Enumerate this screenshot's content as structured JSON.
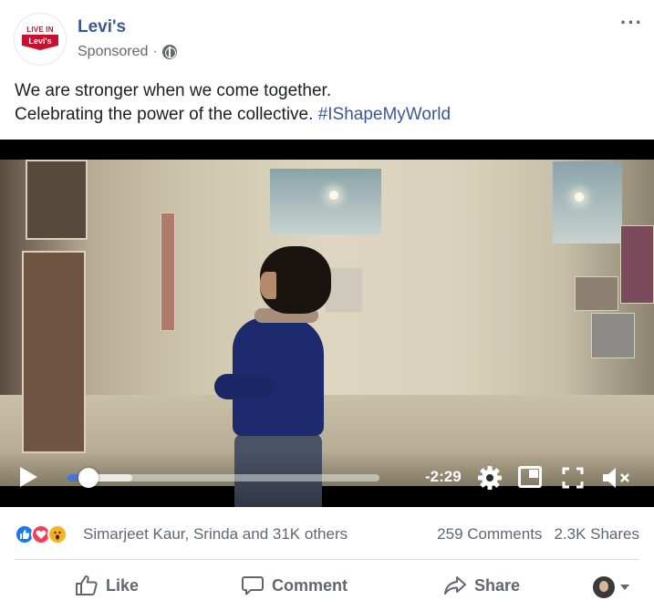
{
  "post": {
    "page_name": "Levi's",
    "sponsored_label": "Sponsored",
    "sponsored_separator": "·",
    "more_icon": "···",
    "logo": {
      "top_text": "LIVE IN",
      "brand_text": "Levi's",
      "color": "#c8102e"
    },
    "caption_line1": "We are stronger when we come together.",
    "caption_line2_text": "Celebrating the power of the collective. ",
    "hashtag": "#IShapeMyWorld"
  },
  "video": {
    "remaining_time": "-2:29",
    "progress_fraction": 0.07,
    "buffered_fraction": 0.21,
    "icons": [
      "play-icon",
      "settings-gear-icon",
      "picture-in-picture-icon",
      "fullscreen-icon",
      "muted-speaker-icon"
    ]
  },
  "engagement": {
    "reaction_icons": [
      "like",
      "love",
      "wow"
    ],
    "reactors": "Simarjeet Kaur, Srinda and 31K others",
    "comments": "259 Comments",
    "shares": "2.3K Shares"
  },
  "actions": {
    "like": "Like",
    "comment": "Comment",
    "share": "Share"
  },
  "colors": {
    "link": "#385898",
    "muted_text": "#606770",
    "like_blue": "#1877f2",
    "love_red": "#f33e58",
    "wow_yellow": "#f7b125",
    "progress_blue": "#4a76d1"
  }
}
